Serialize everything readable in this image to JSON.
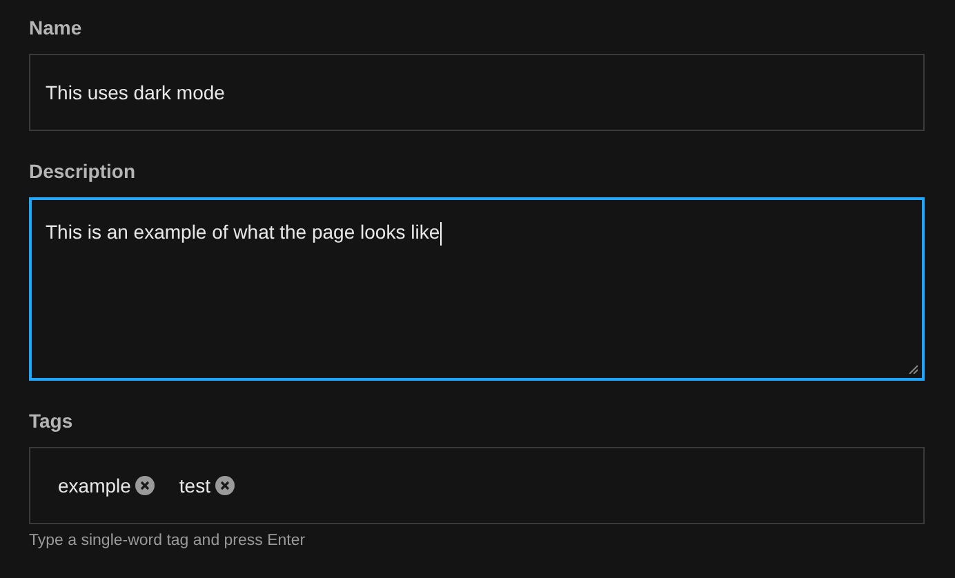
{
  "fields": [
    {
      "kind": "input",
      "label": "Name",
      "value": "This uses dark mode",
      "focused": false
    },
    {
      "kind": "textarea",
      "label": "Description",
      "value": "This is an example of what the page looks like",
      "focused": true
    },
    {
      "kind": "tags",
      "label": "Tags",
      "tags": [
        "example",
        "test"
      ],
      "help": "Type a single-word tag and press Enter",
      "focused": false
    }
  ]
}
